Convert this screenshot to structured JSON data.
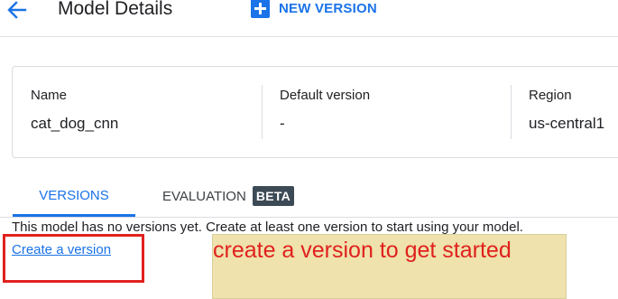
{
  "header": {
    "title": "Model Details",
    "new_version_label": "NEW VERSION"
  },
  "details": [
    {
      "label": "Name",
      "value": "cat_dog_cnn"
    },
    {
      "label": "Default version",
      "value": "-"
    },
    {
      "label": "Region",
      "value": "us-central1"
    }
  ],
  "tabs": [
    {
      "label": "VERSIONS",
      "active": true
    },
    {
      "label": "EVALUATION",
      "badge": "BETA",
      "active": false
    }
  ],
  "content": {
    "message": "This model has no versions yet. Create at least one version to start using your model.",
    "create_link": "Create a version"
  },
  "annotation": {
    "text": "create a version to get started",
    "text_color": "#e0211e",
    "box_color": "#efe2ac"
  },
  "colors": {
    "accent": "#1a73e8",
    "highlight_border": "#e0211e"
  }
}
